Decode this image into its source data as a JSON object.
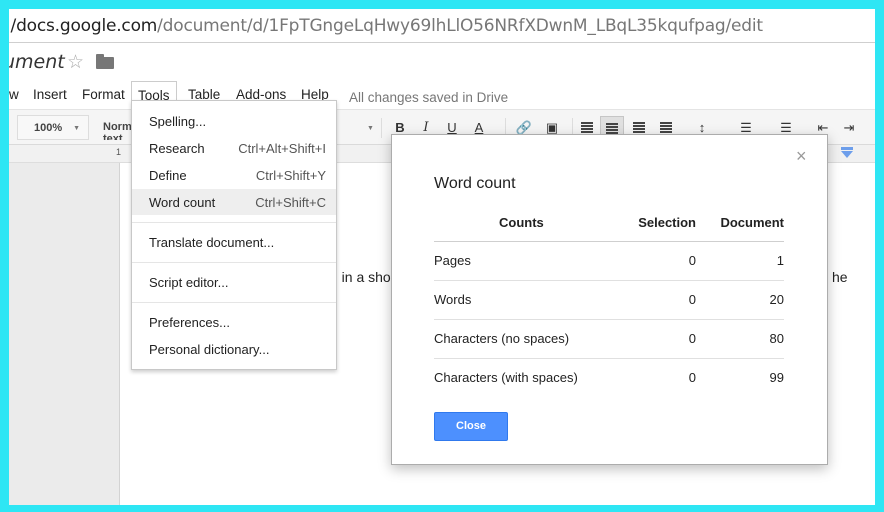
{
  "browser": {
    "url_host": "docs.google.com",
    "url_path": "/document/d/1FpTGngeLqHwy69lhLlO56NRfXDwnM_LBqL35kqufpag/edit",
    "url_prefix": ":/"
  },
  "document": {
    "title": "ument",
    "star_icon": "star-icon",
    "folder_icon": "folder-icon",
    "body_text_visible": "g in a sho",
    "body_text_right": "he"
  },
  "menubar": {
    "items": [
      "w",
      "Insert",
      "Format",
      "Tools",
      "Table",
      "Add-ons",
      "Help"
    ],
    "active": "Tools",
    "status": "All changes saved in Drive"
  },
  "toolbar": {
    "zoom": "100%",
    "style": "Normal text",
    "bold": "B",
    "italic": "I",
    "underline": "U",
    "text_color": "A"
  },
  "ruler": {
    "first_mark": "1"
  },
  "tools_menu": {
    "items": [
      {
        "label": "Spelling...",
        "shortcut": ""
      },
      {
        "label": "Research",
        "shortcut": "Ctrl+Alt+Shift+I"
      },
      {
        "label": "Define",
        "shortcut": "Ctrl+Shift+Y"
      },
      {
        "label": "Word count",
        "shortcut": "Ctrl+Shift+C"
      },
      {
        "label": "Translate document...",
        "shortcut": ""
      },
      {
        "label": "Script editor...",
        "shortcut": ""
      },
      {
        "label": "Preferences...",
        "shortcut": ""
      },
      {
        "label": "Personal dictionary...",
        "shortcut": ""
      }
    ],
    "highlighted": "Word count"
  },
  "word_count_dialog": {
    "title": "Word count",
    "columns": [
      "Counts",
      "Selection",
      "Document"
    ],
    "rows": [
      {
        "label": "Pages",
        "selection": "0",
        "document": "1"
      },
      {
        "label": "Words",
        "selection": "0",
        "document": "20"
      },
      {
        "label": "Characters (no spaces)",
        "selection": "0",
        "document": "80"
      },
      {
        "label": "Characters (with spaces)",
        "selection": "0",
        "document": "99"
      }
    ],
    "close_label": "Close",
    "close_icon": "×"
  },
  "colors": {
    "screen_border": "#2ee6f4",
    "primary_button": "#4d90fe",
    "ruler_marker": "#6d9eeb"
  }
}
